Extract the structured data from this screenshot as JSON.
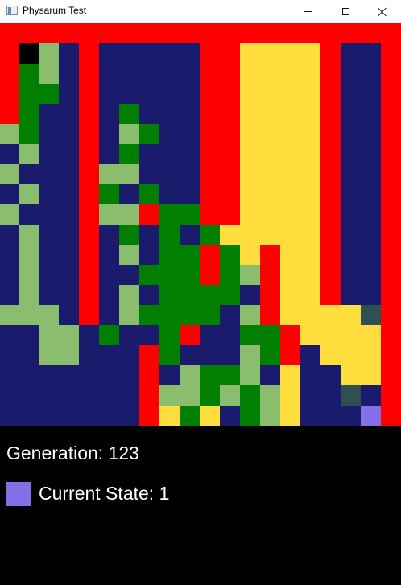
{
  "window": {
    "title": "Physarum Test"
  },
  "palette": {
    "0": "#ff0000",
    "1": "#1b1b6e",
    "2": "#8bbd6e",
    "3": "#007f00",
    "4": "#ffdd3c",
    "5": "#000000",
    "6": "#2e5050",
    "7": "#8470e6"
  },
  "grid": {
    "rows": 20,
    "cols": 20,
    "cells": [
      "00000000000000000000",
      "05210111110044440110",
      "03210111110044440110",
      "03310111110044440110",
      "03110131110044440110",
      "23110123110044440110",
      "12110131110044440110",
      "21110221110044440110",
      "12110313110044440110",
      "21110220330044440110",
      "12110131313444440110",
      "12110121330340440110",
      "12110113330320440110",
      "12110121333310440110",
      "22210123333120444460",
      "11221311301133044440",
      "11221110311123014440",
      "11111110123321411440",
      "11111110223232411610",
      "11111110434132411170"
    ]
  },
  "status": {
    "generation_text": "Generation: 123",
    "state_text": "Current State: 1",
    "state_color": "#8470e6"
  }
}
